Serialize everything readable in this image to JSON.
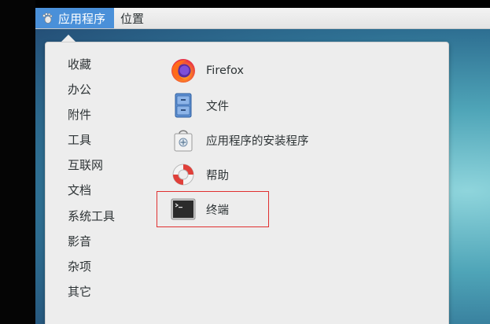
{
  "panel": {
    "applications_label": "应用程序",
    "places_label": "位置"
  },
  "categories": [
    "收藏",
    "办公",
    "附件",
    "工具",
    "互联网",
    "文档",
    "系统工具",
    "影音",
    "杂项",
    "其它"
  ],
  "apps": [
    {
      "label": "Firefox",
      "icon": "firefox-icon"
    },
    {
      "label": "文件",
      "icon": "file-cabinet-icon"
    },
    {
      "label": "应用程序的安装程序",
      "icon": "software-bag-icon"
    },
    {
      "label": "帮助",
      "icon": "lifebuoy-icon"
    },
    {
      "label": "终端",
      "icon": "terminal-icon"
    }
  ],
  "colors": {
    "panel_active": "#4a90d9",
    "selection_outline": "#e03030"
  }
}
